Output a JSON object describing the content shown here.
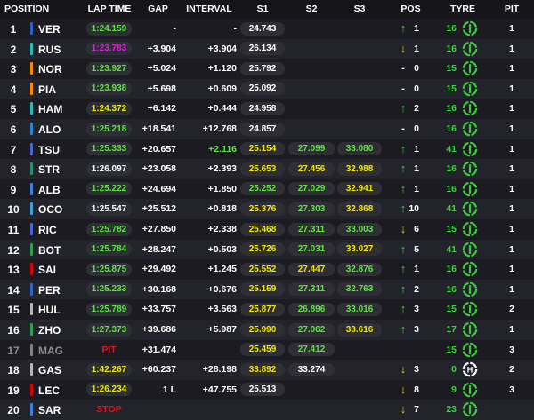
{
  "headers": {
    "position": "POSITION",
    "lap_time": "LAP TIME",
    "gap": "GAP",
    "interval": "INTERVAL",
    "s1": "S1",
    "s2": "S2",
    "s3": "S3",
    "pos": "POS",
    "tyre": "TYRE",
    "pit": "PIT"
  },
  "colors": {
    "purple": "#e11de1",
    "green": "#5ae63c",
    "yellow": "#f0e600",
    "white": "#ffffff",
    "grey": "#8c8c8c",
    "red": "#e1141e",
    "arrow_up": "#3cd23c",
    "arrow_down": "#f0c800",
    "tyre_soft": "#e1141e",
    "tyre_medium": "#f0d200",
    "tyre_hard": "#ffffff",
    "tyre_intermediate": "#3cc83c",
    "tyre_wet": "#2878e6"
  },
  "rows": [
    {
      "pos": "1",
      "team_color": "#2a62c6",
      "driver": "VER",
      "lap": "1:24.159",
      "lap_color": "green",
      "gap": "-",
      "interval": "-",
      "interval_color": "white",
      "s1": "24.743",
      "s1_color": "white",
      "s2": "",
      "s2_color": "white",
      "s3": "",
      "s3_color": "white",
      "arrow": "up",
      "change": "1",
      "laps": "16",
      "tyre": "intermediate",
      "pit": "1"
    },
    {
      "pos": "2",
      "team_color": "#28b9b9",
      "driver": "RUS",
      "lap": "1:23.783",
      "lap_color": "purple",
      "gap": "+3.904",
      "interval": "+3.904",
      "interval_color": "white",
      "s1": "26.134",
      "s1_color": "white",
      "s2": "",
      "s2_color": "white",
      "s3": "",
      "s3_color": "white",
      "arrow": "down",
      "change": "1",
      "laps": "16",
      "tyre": "intermediate",
      "pit": "1"
    },
    {
      "pos": "3",
      "team_color": "#ff8700",
      "driver": "NOR",
      "lap": "1:23.927",
      "lap_color": "green",
      "gap": "+5.024",
      "interval": "+1.120",
      "interval_color": "white",
      "s1": "25.792",
      "s1_color": "white",
      "s2": "",
      "s2_color": "white",
      "s3": "",
      "s3_color": "white",
      "arrow": "none",
      "change": "0",
      "laps": "15",
      "tyre": "intermediate",
      "pit": "1"
    },
    {
      "pos": "4",
      "team_color": "#ff8700",
      "driver": "PIA",
      "lap": "1:23.938",
      "lap_color": "green",
      "gap": "+5.698",
      "interval": "+0.609",
      "interval_color": "white",
      "s1": "25.092",
      "s1_color": "white",
      "s2": "",
      "s2_color": "white",
      "s3": "",
      "s3_color": "white",
      "arrow": "none",
      "change": "0",
      "laps": "15",
      "tyre": "intermediate",
      "pit": "1"
    },
    {
      "pos": "5",
      "team_color": "#28b9b9",
      "driver": "HAM",
      "lap": "1:24.372",
      "lap_color": "yellow",
      "gap": "+6.142",
      "interval": "+0.444",
      "interval_color": "white",
      "s1": "24.958",
      "s1_color": "white",
      "s2": "",
      "s2_color": "white",
      "s3": "",
      "s3_color": "white",
      "arrow": "up",
      "change": "2",
      "laps": "16",
      "tyre": "intermediate",
      "pit": "1"
    },
    {
      "pos": "6",
      "team_color": "#2d82c8",
      "driver": "ALO",
      "lap": "1:25.218",
      "lap_color": "green",
      "gap": "+18.541",
      "interval": "+12.768",
      "interval_color": "white",
      "s1": "24.857",
      "s1_color": "white",
      "s2": "",
      "s2_color": "white",
      "s3": "",
      "s3_color": "white",
      "arrow": "none",
      "change": "0",
      "laps": "16",
      "tyre": "intermediate",
      "pit": "1"
    },
    {
      "pos": "7",
      "team_color": "#4664d2",
      "driver": "TSU",
      "lap": "1:25.333",
      "lap_color": "green",
      "gap": "+20.657",
      "interval": "+2.116",
      "interval_color": "green",
      "s1": "25.154",
      "s1_color": "yellow",
      "s2": "27.099",
      "s2_color": "green",
      "s3": "33.080",
      "s3_color": "green",
      "arrow": "up",
      "change": "1",
      "laps": "41",
      "tyre": "intermediate",
      "pit": "1"
    },
    {
      "pos": "8",
      "team_color": "#2d8c78",
      "driver": "STR",
      "lap": "1:26.097",
      "lap_color": "white",
      "gap": "+23.058",
      "interval": "+2.393",
      "interval_color": "white",
      "s1": "25.653",
      "s1_color": "yellow",
      "s2": "27.456",
      "s2_color": "yellow",
      "s3": "32.988",
      "s3_color": "yellow",
      "arrow": "up",
      "change": "1",
      "laps": "16",
      "tyre": "intermediate",
      "pit": "1"
    },
    {
      "pos": "9",
      "team_color": "#3c82dc",
      "driver": "ALB",
      "lap": "1:25.222",
      "lap_color": "green",
      "gap": "+24.694",
      "interval": "+1.850",
      "interval_color": "white",
      "s1": "25.252",
      "s1_color": "green",
      "s2": "27.029",
      "s2_color": "green",
      "s3": "32.941",
      "s3_color": "yellow",
      "arrow": "up",
      "change": "1",
      "laps": "16",
      "tyre": "intermediate",
      "pit": "1"
    },
    {
      "pos": "10",
      "team_color": "#3ca0dc",
      "driver": "OCO",
      "lap": "1:25.547",
      "lap_color": "white",
      "gap": "+25.512",
      "interval": "+0.818",
      "interval_color": "white",
      "s1": "25.376",
      "s1_color": "yellow",
      "s2": "27.303",
      "s2_color": "green",
      "s3": "32.868",
      "s3_color": "yellow",
      "arrow": "up",
      "change": "10",
      "laps": "41",
      "tyre": "intermediate",
      "pit": "1"
    },
    {
      "pos": "11",
      "team_color": "#4664d2",
      "driver": "RIC",
      "lap": "1:25.782",
      "lap_color": "green",
      "gap": "+27.850",
      "interval": "+2.338",
      "interval_color": "white",
      "s1": "25.468",
      "s1_color": "yellow",
      "s2": "27.311",
      "s2_color": "green",
      "s3": "33.003",
      "s3_color": "green",
      "arrow": "down",
      "change": "6",
      "laps": "15",
      "tyre": "intermediate",
      "pit": "1"
    },
    {
      "pos": "12",
      "team_color": "#2da050",
      "driver": "BOT",
      "lap": "1:25.784",
      "lap_color": "green",
      "gap": "+28.247",
      "interval": "+0.503",
      "interval_color": "white",
      "s1": "25.726",
      "s1_color": "yellow",
      "s2": "27.031",
      "s2_color": "green",
      "s3": "33.027",
      "s3_color": "yellow",
      "arrow": "up",
      "change": "5",
      "laps": "41",
      "tyre": "intermediate",
      "pit": "1"
    },
    {
      "pos": "13",
      "team_color": "#dc0000",
      "driver": "SAI",
      "lap": "1:25.875",
      "lap_color": "green",
      "gap": "+29.492",
      "interval": "+1.245",
      "interval_color": "white",
      "s1": "25.552",
      "s1_color": "yellow",
      "s2": "27.447",
      "s2_color": "yellow",
      "s3": "32.876",
      "s3_color": "green",
      "arrow": "up",
      "change": "1",
      "laps": "16",
      "tyre": "intermediate",
      "pit": "1"
    },
    {
      "pos": "14",
      "team_color": "#3064c8",
      "driver": "PER",
      "lap": "1:25.233",
      "lap_color": "green",
      "gap": "+30.168",
      "interval": "+0.676",
      "interval_color": "white",
      "s1": "25.159",
      "s1_color": "yellow",
      "s2": "27.311",
      "s2_color": "green",
      "s3": "32.763",
      "s3_color": "green",
      "arrow": "up",
      "change": "2",
      "laps": "16",
      "tyre": "intermediate",
      "pit": "1"
    },
    {
      "pos": "15",
      "team_color": "#b4b4b4",
      "driver": "HUL",
      "lap": "1:25.789",
      "lap_color": "green",
      "gap": "+33.757",
      "interval": "+3.563",
      "interval_color": "white",
      "s1": "25.877",
      "s1_color": "yellow",
      "s2": "26.896",
      "s2_color": "green",
      "s3": "33.016",
      "s3_color": "green",
      "arrow": "up",
      "change": "3",
      "laps": "15",
      "tyre": "intermediate",
      "pit": "2"
    },
    {
      "pos": "16",
      "team_color": "#2da050",
      "driver": "ZHO",
      "lap": "1:27.373",
      "lap_color": "green",
      "gap": "+39.686",
      "interval": "+5.987",
      "interval_color": "white",
      "s1": "25.990",
      "s1_color": "yellow",
      "s2": "27.062",
      "s2_color": "green",
      "s3": "33.616",
      "s3_color": "yellow",
      "arrow": "up",
      "change": "3",
      "laps": "17",
      "tyre": "intermediate",
      "pit": "1"
    },
    {
      "pos": "17",
      "team_color": "#828282",
      "driver": "MAG",
      "status": "PIT",
      "status_color": "red",
      "lap": "",
      "lap_color": "white",
      "gap": "+31.474",
      "interval": "",
      "interval_color": "white",
      "s1": "25.459",
      "s1_color": "yellow",
      "s2": "27.412",
      "s2_color": "green",
      "s3": "",
      "s3_color": "white",
      "arrow": "none",
      "change": "",
      "laps": "15",
      "tyre": "intermediate",
      "pit": "3",
      "retired": true
    },
    {
      "pos": "18",
      "team_color": "#b4b4b4",
      "driver": "GAS",
      "lap": "1:42.267",
      "lap_color": "yellow",
      "gap": "+60.237",
      "interval": "+28.198",
      "interval_color": "white",
      "s1": "33.892",
      "s1_color": "yellow",
      "s2": "33.274",
      "s2_color": "white",
      "s3": "",
      "s3_color": "white",
      "arrow": "down",
      "change": "3",
      "laps": "0",
      "tyre": "hard",
      "pit": "2"
    },
    {
      "pos": "19",
      "team_color": "#dc0000",
      "driver": "LEC",
      "lap": "1:26.234",
      "lap_color": "yellow",
      "gap": "1 L",
      "interval": "+47.755",
      "interval_color": "white",
      "s1": "25.513",
      "s1_color": "white",
      "s2": "",
      "s2_color": "white",
      "s3": "",
      "s3_color": "white",
      "arrow": "down",
      "change": "8",
      "laps": "9",
      "tyre": "intermediate",
      "pit": "3"
    },
    {
      "pos": "20",
      "team_color": "#3c82dc",
      "driver": "SAR",
      "status": "STOP",
      "status_color": "red",
      "lap": "",
      "lap_color": "white",
      "gap": "",
      "interval": "",
      "interval_color": "white",
      "s1": "",
      "s1_color": "white",
      "s2": "",
      "s2_color": "white",
      "s3": "",
      "s3_color": "white",
      "arrow": "down",
      "change": "7",
      "laps": "23",
      "tyre": "intermediate",
      "pit": ""
    }
  ]
}
